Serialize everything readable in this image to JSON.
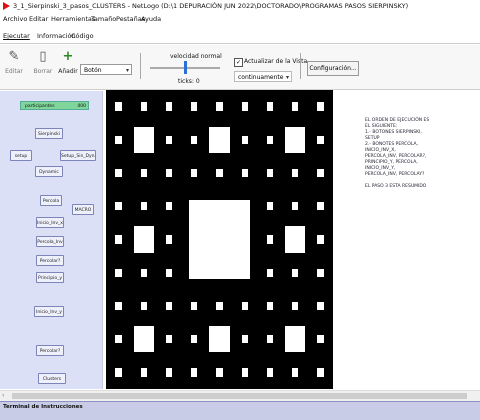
{
  "window": {
    "title": "3_1_Sierpinski_3_pasos_CLUSTERS - NetLogo (D:\\1 DEPURACIÓN JUN 2022\\DOCTORADO\\PROGRAMAS PASOS SIERPINSKY)"
  },
  "menu": [
    "Archivo",
    "Editar",
    "Herramientas",
    "Tamaño",
    "Pestañas",
    "Ayuda"
  ],
  "tabs": [
    "Ejecutar",
    "Información",
    "Código"
  ],
  "toolbar": {
    "edit_label": "Editar",
    "delete_label": "Borrar",
    "add_label": "Añadir",
    "widget_type": "Botón",
    "speed_label": "velocidad normal",
    "ticks_label": "ticks: 0",
    "view_update_label": "Actualizar de la Vista...",
    "view_update_mode": "continuamente",
    "settings_label": "Configuración..."
  },
  "interface": {
    "monitor": {
      "label": "participantes",
      "value": "400"
    },
    "buttons": [
      "Sierpinski",
      "setup",
      "Setup_Sin_Dyna",
      "Dynamic",
      "Percola",
      "MACRO",
      "Inicio_Inv_x",
      "Percola_Inv",
      "Percolar?",
      "Principio_y",
      "Inicio_Inv_y",
      "Percolar?",
      "Clusters"
    ]
  },
  "notes": [
    "EL ORDEN DE EJECUCIÓN ES",
    "EL SIGUIENTE:",
    "1.- BOTONES SIERPINSKI,",
    "SETUP",
    "2.- BONOTES PERCOLA,",
    "INICIO_INV_X,",
    "PERCOLA_INV, PERCOLAR?,",
    "PRINCIPIO_Y, PERCOLA,",
    "INICIO_INV_Y,",
    "PERCOLA_INV, PERCOLAY?",
    "",
    "EL PASO 3 ESTA RESUMIDO"
  ],
  "command_center": {
    "label": "Terminal de Instrucciones"
  },
  "colors": {
    "interface_bg": "#dce0f6",
    "monitor_bg": "#7fd59a",
    "world_bg": "#000000",
    "cell_color": "#ffffff"
  },
  "icons": [
    "edit-icon",
    "delete-icon",
    "add-icon",
    "checkbox-icon",
    "scroll-left-icon"
  ]
}
